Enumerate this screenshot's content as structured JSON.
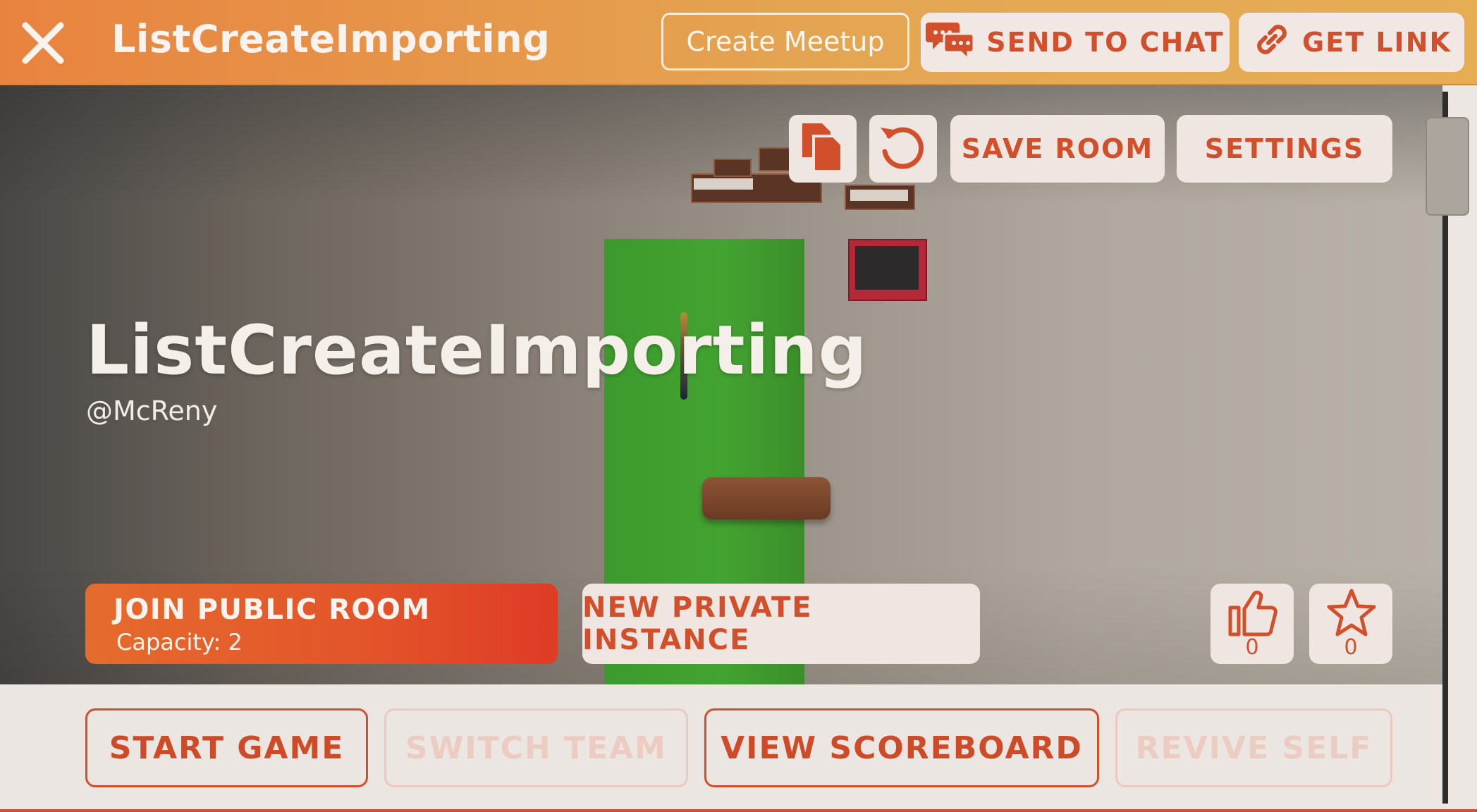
{
  "header": {
    "title": "ListCreateImporting",
    "create_meetup_label": "Create Meetup",
    "send_to_chat_label": "SEND TO CHAT",
    "get_link_label": "GET LINK"
  },
  "room": {
    "title": "ListCreateImporting",
    "author": "@McReny"
  },
  "room_actions": {
    "save_room_label": "SAVE ROOM",
    "settings_label": "SETTINGS"
  },
  "join": {
    "join_public_label": "JOIN PUBLIC ROOM",
    "capacity_text": "Capacity: 2",
    "new_private_label": "NEW PRIVATE INSTANCE"
  },
  "ratings": {
    "likes": "0",
    "favorites": "0"
  },
  "game_controls": {
    "start_game_label": "START GAME",
    "switch_team_label": "SWITCH TEAM",
    "view_scoreboard_label": "VIEW SCOREBOARD",
    "revive_self_label": "REVIVE SELF"
  },
  "colors": {
    "accent": "#d1502b",
    "header_start": "#e8833f",
    "header_end": "#e6ad55",
    "join_gradient_end": "#df3b26",
    "disabled_text": "#ecccc1"
  },
  "icons": [
    "close-icon",
    "chat-bubbles-icon",
    "link-icon",
    "copy-icon",
    "reset-icon",
    "thumbs-up-icon",
    "star-icon"
  ]
}
